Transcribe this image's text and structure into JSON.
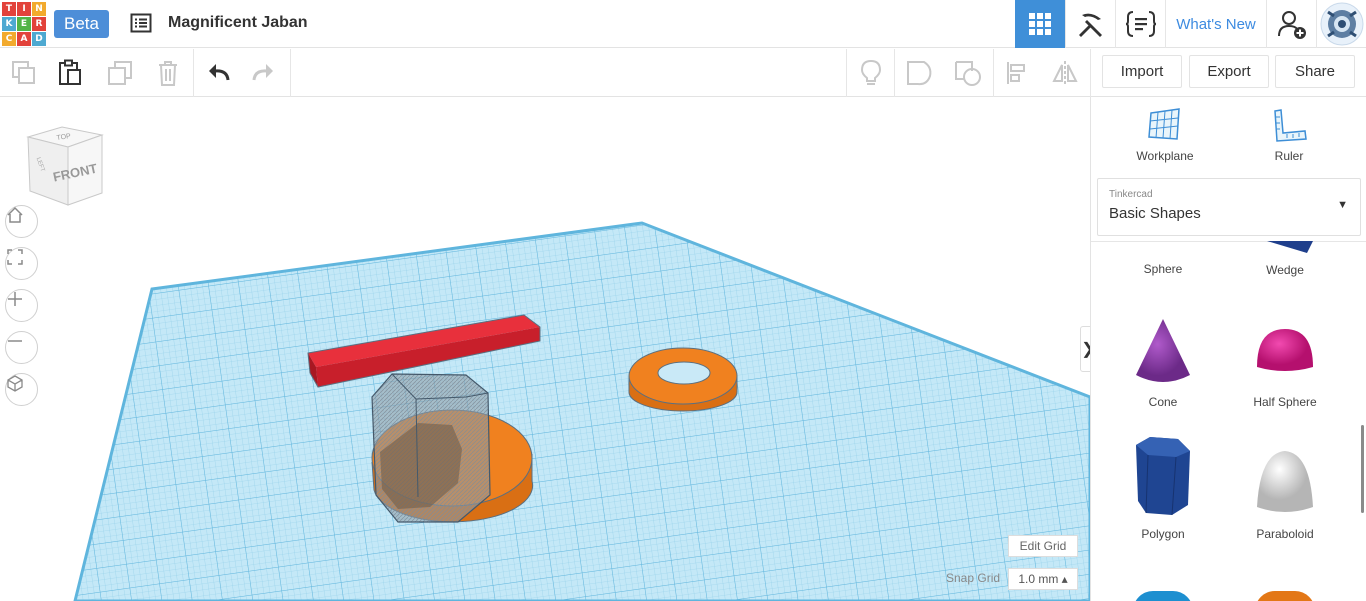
{
  "app": {
    "logo_letters": [
      "T",
      "I",
      "N",
      "K",
      "E",
      "R",
      "C",
      "A",
      "D"
    ],
    "logo_colors": [
      "#e2423a",
      "#e2423a",
      "#f2aa2d",
      "#4ea9d1",
      "#52b447",
      "#e2423a",
      "#f2aa2d",
      "#e2423a",
      "#4ea9d1"
    ],
    "beta_label": "Beta",
    "design_title": "Magnificent Jaban"
  },
  "header": {
    "grid_view_icon": "grid-icon",
    "build_icon": "pickaxe-icon",
    "code_icon": "code-blocks-icon",
    "whats_new_label": "What's New",
    "add_user_icon": "add-user-icon",
    "avatar_icon": "avatar-icon",
    "accent_color": "#3f8fd8"
  },
  "toolbar": {
    "tools": [
      "copy-icon",
      "paste-icon",
      "duplicate-icon",
      "delete-icon",
      "undo-icon",
      "redo-icon",
      "light-bulb-icon",
      "group-icon",
      "ungroup-icon",
      "align-icon",
      "mirror-icon"
    ],
    "import_label": "Import",
    "export_label": "Export",
    "share_label": "Share"
  },
  "viewcube": {
    "top_label": "TOP",
    "front_label": "FRONT",
    "left_label": "LEFT"
  },
  "nav_controls": [
    "home-icon",
    "fit-view-icon",
    "zoom-in-icon",
    "zoom-out-icon",
    "perspective-icon"
  ],
  "grid_controls": {
    "edit_grid_label": "Edit Grid",
    "snap_grid_label": "Snap Grid",
    "snap_grid_value": "1.0 mm ▴"
  },
  "panel": {
    "workplane_label": "Workplane",
    "ruler_label": "Ruler",
    "library_source": "Tinkercad",
    "library_name": "Basic Shapes",
    "shapes": [
      {
        "label": "Sphere",
        "color": "#2a63a8"
      },
      {
        "label": "Wedge",
        "color": "#1f3f8c"
      },
      {
        "label": "Cone",
        "color": "#8a3fa6"
      },
      {
        "label": "Half Sphere",
        "color": "#e0198a"
      },
      {
        "label": "Polygon",
        "color": "#1f4592"
      },
      {
        "label": "Paraboloid",
        "color": "#d8d8d8"
      }
    ]
  },
  "scene": {
    "workplane_color": "#bfe6f6",
    "box_color": "#e52531",
    "cylinder_color": "#f0811f",
    "ring_color": "#f0811f",
    "hole_color": "#8d9aa6"
  }
}
